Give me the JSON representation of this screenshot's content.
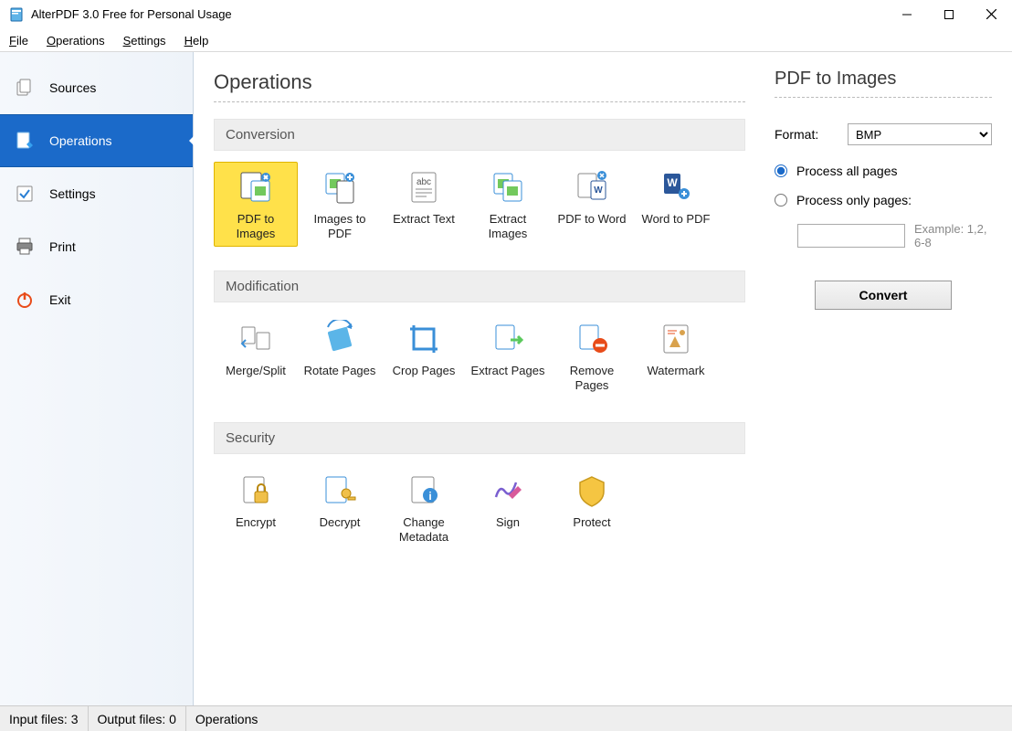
{
  "window": {
    "title": "AlterPDF 3.0 Free for Personal Usage"
  },
  "menu": {
    "file": "File",
    "operations": "Operations",
    "settings": "Settings",
    "help": "Help"
  },
  "sidebar": {
    "items": [
      {
        "label": "Sources"
      },
      {
        "label": "Operations"
      },
      {
        "label": "Settings"
      },
      {
        "label": "Print"
      },
      {
        "label": "Exit"
      }
    ]
  },
  "center": {
    "title": "Operations",
    "sections": [
      "Conversion",
      "Modification",
      "Security"
    ],
    "conversion": [
      "PDF to Images",
      "Images to PDF",
      "Extract Text",
      "Extract Images",
      "PDF to Word",
      "Word to PDF"
    ],
    "modification": [
      "Merge/Split",
      "Rotate Pages",
      "Crop Pages",
      "Extract Pages",
      "Remove Pages",
      "Watermark"
    ],
    "security": [
      "Encrypt",
      "Decrypt",
      "Change Metadata",
      "Sign",
      "Protect"
    ]
  },
  "right": {
    "title": "PDF to Images",
    "format_label": "Format:",
    "format_value": "BMP",
    "process_all": "Process all pages",
    "process_only": "Process only pages:",
    "example": "Example: 1,2, 6-8",
    "convert": "Convert"
  },
  "status": {
    "input": "Input files: 3",
    "output": "Output files: 0",
    "mode": "Operations"
  }
}
